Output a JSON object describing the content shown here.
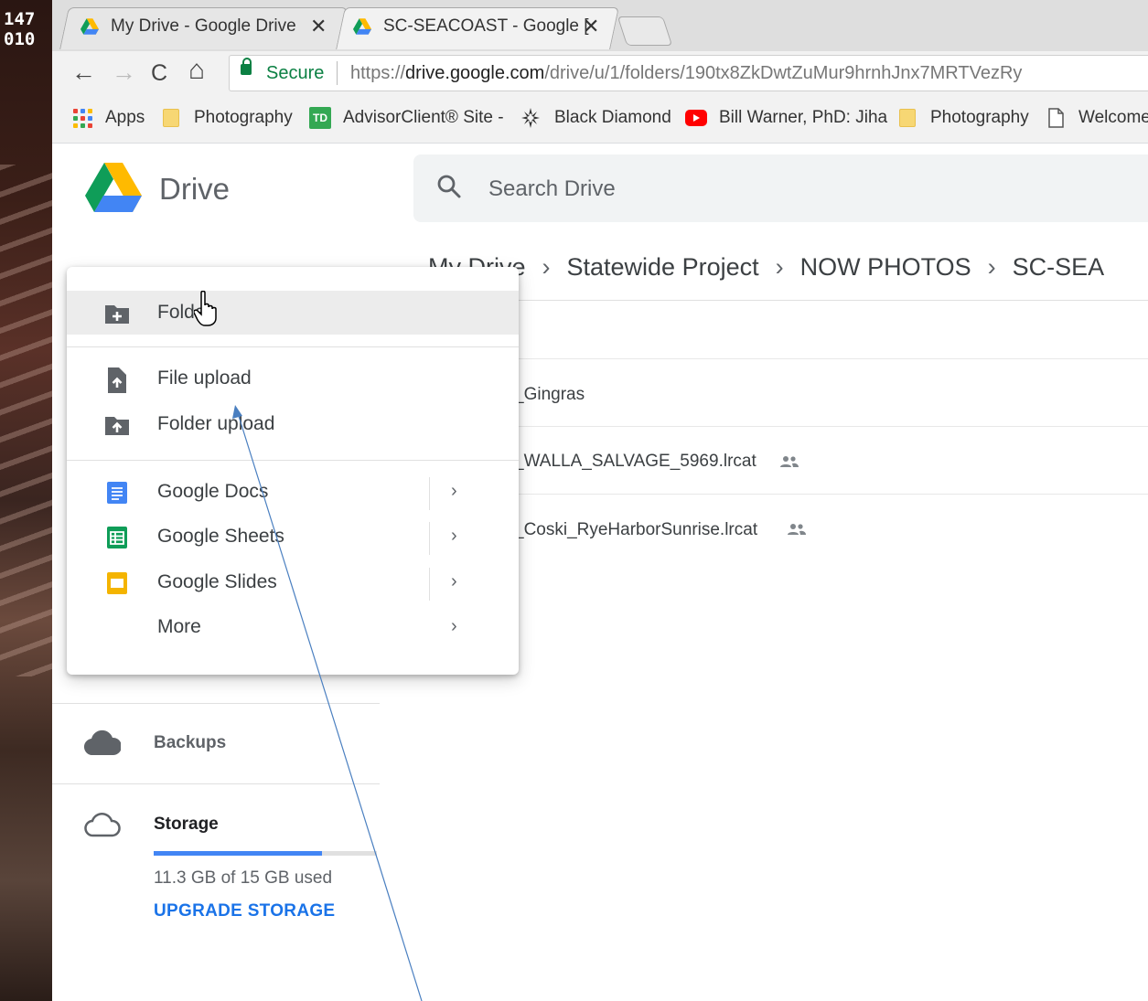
{
  "desktop": {
    "corner_text_1": "147",
    "corner_text_2": "010"
  },
  "browser": {
    "tabs": [
      {
        "title": "My Drive - Google Drive",
        "close": "✕"
      },
      {
        "title": "SC-SEACOAST - Google [",
        "close": "✕"
      }
    ],
    "nav": {
      "back": "←",
      "forward": "→",
      "reload": "C",
      "home": "⌂"
    },
    "secure_label": "Secure",
    "url_scheme": "https://",
    "url_host": "drive.google.com",
    "url_path": "/drive/u/1/folders/190tx8ZkDwtZuMur9hrnhJnx7MRTVezRy",
    "bookmarks": [
      "Apps",
      "Photography",
      "AdvisorClient® Site -",
      "Black Diamond",
      "Bill Warner, PhD: Jiha",
      "Photography",
      "Welcome"
    ]
  },
  "drive": {
    "title": "Drive",
    "search_placeholder": "Search Drive",
    "breadcrumb": [
      "My Drive",
      "Statewide Project",
      "NOW PHOTOS",
      "SC-SEA"
    ],
    "breadcrumb_sep": "›",
    "files": [
      {
        "name": "_Gingras",
        "shared": false
      },
      {
        "name": "_WALLA_SALVAGE_5969.lrcat",
        "shared": true
      },
      {
        "name": "_Coski_RyeHarborSunrise.lrcat",
        "shared": true
      }
    ],
    "sidebar": {
      "backups": "Backups",
      "storage": "Storage",
      "storage_used": "11.3 GB of 15 GB used",
      "storage_fraction": 0.753,
      "upgrade": "UPGRADE STORAGE"
    }
  },
  "menu": {
    "folder": "Folder",
    "file_upload": "File upload",
    "folder_upload": "Folder upload",
    "docs": "Google Docs",
    "sheets": "Google Sheets",
    "slides": "Google Slides",
    "more": "More",
    "chevron": "›"
  },
  "colors": {
    "accent": "#1a73e8",
    "docs": "#4285f4",
    "sheets": "#0f9d58",
    "slides": "#f4b400",
    "youtube": "#ff0000",
    "td": "#34a853"
  }
}
